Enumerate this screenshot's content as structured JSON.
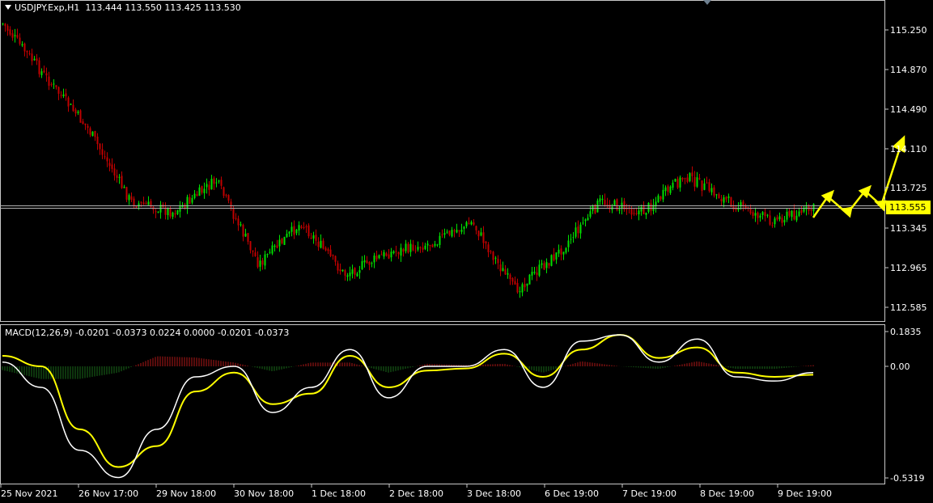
{
  "header": {
    "symbol_label": "USDJPY.Exp,H1",
    "ohlc_values": "113.444 113.550 113.425 113.530"
  },
  "price_axis": {
    "ticks": [
      "115.250",
      "114.870",
      "114.490",
      "114.110",
      "113.725",
      "113.345",
      "112.965",
      "112.585"
    ],
    "current_price": "113.555"
  },
  "macd_panel": {
    "label": "MACD(12,26,9) -0.0201 -0.0373 0.0224 0.0000 -0.0201 -0.0373",
    "ticks": [
      "0.1835",
      "0.00",
      "-0.5319"
    ]
  },
  "time_axis": {
    "labels": [
      "25 Nov 2021",
      "26 Nov 17:00",
      "29 Nov 18:00",
      "30 Nov 18:00",
      "1 Dec 18:00",
      "2 Dec 18:00",
      "3 Dec 18:00",
      "6 Dec 19:00",
      "7 Dec 19:00",
      "8 Dec 19:00",
      "9 Dec 19:00"
    ]
  },
  "colors": {
    "background": "#000000",
    "bull_candle": "#00e000",
    "bear_candle": "#c00000",
    "macd_main_line": "#ffffff",
    "macd_signal_line": "#ffff00",
    "histogram_positive": "#b01818",
    "histogram_negative": "#1a6a1a",
    "forecast_arrows": "#ffff00",
    "price_line": "#b0b0b0",
    "price_tag_bg": "#ffff00"
  },
  "chart_data": {
    "type": "candlestick",
    "symbol": "USDJPY.Exp",
    "timeframe": "H1",
    "price_close_path": [
      {
        "t": "25 Nov 2021",
        "close": 115.31
      },
      {
        "t": "25 Nov evening",
        "close": 114.8
      },
      {
        "t": "26 Nov early",
        "close": 114.3
      },
      {
        "t": "26 Nov 17:00",
        "close": 113.6
      },
      {
        "t": "26 Nov late",
        "close": 113.5
      },
      {
        "t": "29 Nov 18:00",
        "close": 113.8
      },
      {
        "t": "29 Nov late",
        "close": 113.0
      },
      {
        "t": "30 Nov 18:00",
        "close": 113.4
      },
      {
        "t": "30 Nov late",
        "close": 112.9
      },
      {
        "t": "1 Dec 18:00",
        "close": 113.1
      },
      {
        "t": "2 Dec 18:00",
        "close": 113.2
      },
      {
        "t": "2 Dec late",
        "close": 113.4
      },
      {
        "t": "3 Dec 18:00",
        "close": 112.75
      },
      {
        "t": "3 Dec late",
        "close": 113.1
      },
      {
        "t": "6 Dec 19:00",
        "close": 113.6
      },
      {
        "t": "7 Dec 19:00",
        "close": 113.5
      },
      {
        "t": "8 Dec morning",
        "close": 113.85
      },
      {
        "t": "8 Dec 19:00",
        "close": 113.6
      },
      {
        "t": "9 Dec 19:00",
        "close": 113.42
      },
      {
        "t": "last",
        "close": 113.53
      }
    ],
    "ohlc_last": {
      "open": 113.444,
      "high": 113.55,
      "low": 113.425,
      "close": 113.53
    },
    "y_range": [
      112.45,
      115.43
    ],
    "macd": {
      "params": "12,26,9",
      "main": [
        0.02,
        -0.1,
        -0.4,
        -0.53,
        -0.3,
        -0.05,
        0.0,
        -0.22,
        -0.1,
        0.08,
        -0.15,
        0.0,
        0.0,
        0.08,
        -0.1,
        0.12,
        0.15,
        0.02,
        0.13,
        -0.05,
        -0.07,
        -0.03
      ],
      "signal": [
        0.05,
        0.0,
        -0.3,
        -0.48,
        -0.38,
        -0.12,
        -0.03,
        -0.18,
        -0.13,
        0.05,
        -0.1,
        -0.02,
        -0.01,
        0.06,
        -0.05,
        0.08,
        0.15,
        0.04,
        0.09,
        -0.03,
        -0.05,
        -0.04
      ],
      "y_range": [
        -0.5319,
        0.1835
      ]
    },
    "grid": false
  }
}
